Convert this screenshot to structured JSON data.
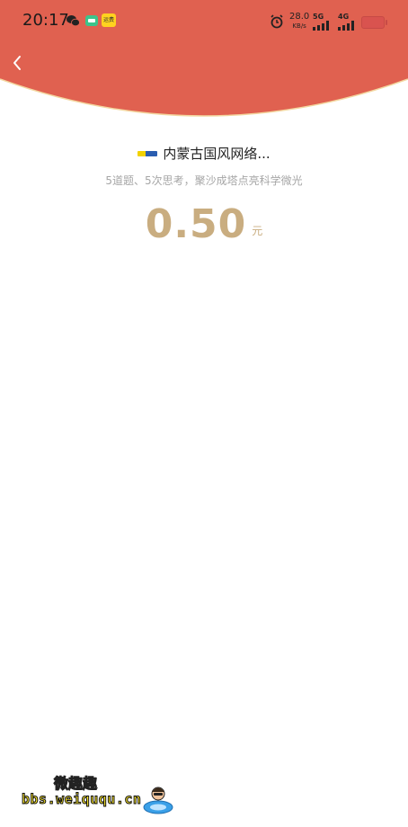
{
  "status_bar": {
    "time": "20:17",
    "speed_value": "28.0",
    "speed_unit": "KB/s",
    "net1": "5G",
    "net2": "4G",
    "notification_badge": "运费"
  },
  "header": {
    "accent_color": "#e06150",
    "back_icon": "chevron-left-icon"
  },
  "red_packet": {
    "merchant_name": "内蒙古国风网络...",
    "blessing": "5道题、5次思考，聚沙成塔点亮科学微光",
    "amount": "0.50",
    "unit": "元",
    "amount_color": "#c9ad80"
  },
  "watermark": {
    "title": "微趣趣",
    "url": "bbs.weiququ.cn"
  }
}
